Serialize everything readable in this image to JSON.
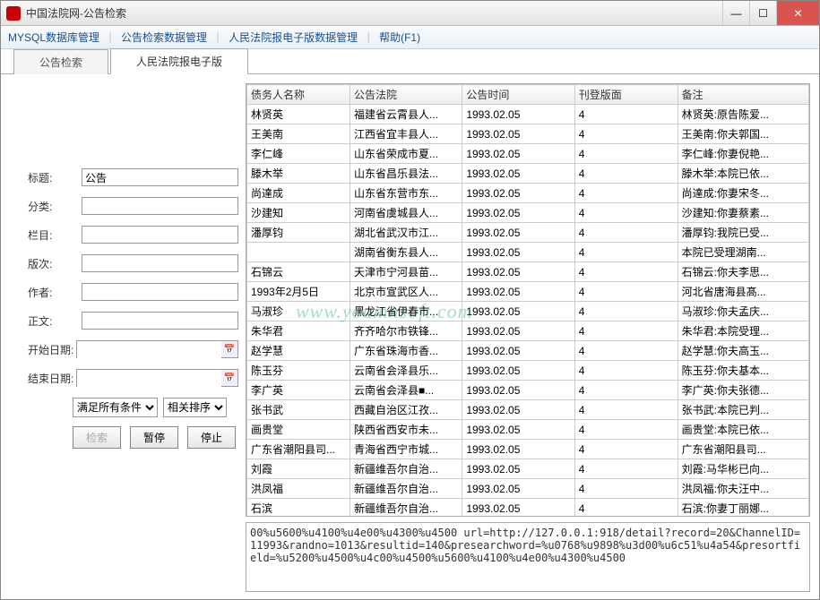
{
  "window": {
    "title": "中国法院网-公告检索",
    "min": "—",
    "max": "☐",
    "close": "✕"
  },
  "menu": {
    "items": [
      "MYSQL数据库管理",
      "公告检索数据管理",
      "人民法院报电子版数据管理",
      "帮助(F1)"
    ]
  },
  "tabs": {
    "items": [
      {
        "label": "公告检索",
        "active": false
      },
      {
        "label": "人民法院报电子版",
        "active": true
      }
    ]
  },
  "form": {
    "labels": {
      "title": "标题:",
      "category": "分类:",
      "column": "栏目:",
      "edition": "版次:",
      "author": "作者:",
      "body": "正文:",
      "start": "开始日期:",
      "end": "结束日期:"
    },
    "values": {
      "title": "公告",
      "category": "",
      "column": "",
      "edition": "",
      "author": "",
      "body": "",
      "start": "",
      "end": ""
    },
    "selects": {
      "cond": "满足所有条件",
      "sort": "相关排序"
    },
    "buttons": {
      "search": "检索",
      "pause": "暂停",
      "stop": "停止"
    }
  },
  "grid": {
    "headers": [
      "债务人名称",
      "公告法院",
      "公告时间",
      "刊登版面",
      "备注"
    ],
    "rows": [
      [
        "林贤英",
        "福建省云霄县人...",
        "1993.02.05",
        "4",
        "林贤英:原告陈爱..."
      ],
      [
        "王美南",
        "江西省宜丰县人...",
        "1993.02.05",
        "4",
        "王美南:你夫郭国..."
      ],
      [
        "李仁峰",
        "山东省荣成市夏...",
        "1993.02.05",
        "4",
        "李仁峰:你妻倪艳..."
      ],
      [
        "滕木举",
        "山东省昌乐县法...",
        "1993.02.05",
        "4",
        "滕木举:本院已依..."
      ],
      [
        "尚達成",
        "山东省东营市东...",
        "1993.02.05",
        "4",
        "尚達成:你妻宋冬..."
      ],
      [
        "沙建知",
        "河南省虞城县人...",
        "1993.02.05",
        "4",
        "沙建知:你妻蔡素..."
      ],
      [
        "潘厚钧",
        "湖北省武汉市江...",
        "1993.02.05",
        "4",
        "潘厚钧:我院已受..."
      ],
      [
        "",
        "湖南省衡东县人...",
        "1993.02.05",
        "4",
        "本院已受理湖南..."
      ],
      [
        "石锦云",
        "天津市宁河县苗...",
        "1993.02.05",
        "4",
        "石锦云:你夫李思..."
      ],
      [
        "1993年2月5日",
        "北京市宣武区人...",
        "1993.02.05",
        "4",
        "河北省唐海县髙..."
      ],
      [
        "马淑珍",
        "黑龙江省伊春市...",
        "1993.02.05",
        "4",
        "马淑珍:你夫孟庆..."
      ],
      [
        "朱华君",
        "齐齐哈尔市铁锋...",
        "1993.02.05",
        "4",
        "朱华君:本院受理..."
      ],
      [
        "赵学慧",
        "广东省珠海市香...",
        "1993.02.05",
        "4",
        "赵学慧:你夫高玉..."
      ],
      [
        "陈玉芬",
        "云南省会泽县乐...",
        "1993.02.05",
        "4",
        "陈玉芬:你夫基本..."
      ],
      [
        "李广英",
        "云南省会泽县■...",
        "1993.02.05",
        "4",
        "李广英:你夫张德..."
      ],
      [
        "张书武",
        "西藏自治区江孜...",
        "1993.02.05",
        "4",
        "张书武:本院已判..."
      ],
      [
        "画贵堂",
        "陕西省西安市未...",
        "1993.02.05",
        "4",
        "画贵堂:本院已依..."
      ],
      [
        "广东省潮阳县司...",
        "青海省西宁市城...",
        "1993.02.05",
        "4",
        "广东省潮阳县司..."
      ],
      [
        "刘霞",
        "新疆维吾尔自治...",
        "1993.02.05",
        "4",
        "刘霞:马华彬已向..."
      ],
      [
        "洪凤福",
        "新疆维吾尔自治...",
        "1993.02.05",
        "4",
        "洪凤福:你夫汪中..."
      ],
      [
        "石滨",
        "新疆维吾尔自治...",
        "1993.02.05",
        "4",
        "石滨:你妻丁丽娜..."
      ]
    ]
  },
  "log": "00%u5600%u4100%u4e00%u4300%u4500\nurl=http://127.0.0.1:918/detail?record=20&ChannelID=11993&randno=1013&resultid=140&presearchword=%u0768%u9898%u3d00%u6c51%u4a54&presortfield=%u5200%u4500%u4c00%u4500%u5600%u4100%u4e00%u4300%u4500",
  "watermark": "www.youmnsoft.com"
}
